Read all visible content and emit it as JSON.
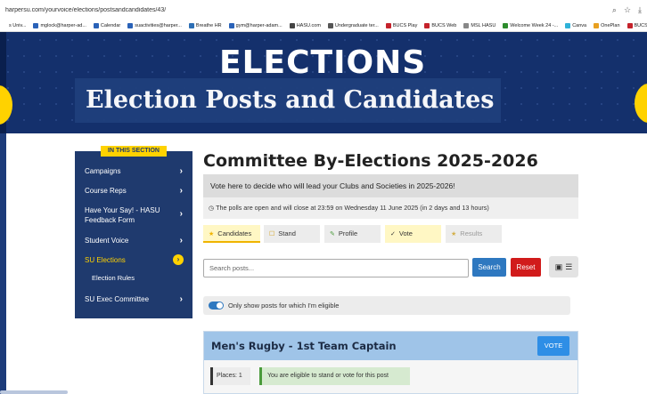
{
  "browser": {
    "url": "harpersu.com/yourvoice/elections/postsandcandidates/43/",
    "bookmarks": [
      {
        "label": "s Univ...",
        "color": "#ffffff"
      },
      {
        "label": "mglock@harper-ad...",
        "color": "#2a62b8"
      },
      {
        "label": "Calendar",
        "color": "#2a62b8"
      },
      {
        "label": "suactivities@harper...",
        "color": "#2a62b8"
      },
      {
        "label": "Breathe HR",
        "color": "#2d6fb5"
      },
      {
        "label": "gym@harper-adam...",
        "color": "#2a62b8"
      },
      {
        "label": "HASU.com",
        "color": "#444444"
      },
      {
        "label": "Undergraduate ter...",
        "color": "#555555"
      },
      {
        "label": "BUCS Play",
        "color": "#c5222b"
      },
      {
        "label": "BUCS Web",
        "color": "#c5222b"
      },
      {
        "label": "MSL HASU",
        "color": "#888888"
      },
      {
        "label": "Welcome Week 24 -...",
        "color": "#2d8c2d"
      },
      {
        "label": "Canva",
        "color": "#2fb2d8"
      },
      {
        "label": "OnePlan",
        "color": "#e8a020"
      },
      {
        "label": "BUCS",
        "color": "#c5222b"
      }
    ]
  },
  "hero": {
    "elections": "ELECTIONS",
    "title": "Election Posts and Candidates"
  },
  "sidebar": {
    "tag": "IN THIS SECTION",
    "items": [
      {
        "label": "Campaigns",
        "chevron": "›"
      },
      {
        "label": "Course Reps",
        "chevron": "›"
      },
      {
        "label": "Have Your Say! - HASU",
        "label2": "Feedback Form",
        "chevron": "›"
      },
      {
        "label": "Student Voice",
        "chevron": "›"
      },
      {
        "label": "SU Elections",
        "chevron": "›"
      },
      {
        "label": "Election Rules"
      },
      {
        "label": "SU Exec Committee",
        "chevron": "›"
      }
    ]
  },
  "main": {
    "heading": "Committee By-Elections 2025-2026",
    "banner": "Vote here to decide who will lead your Clubs and Societies in 2025-2026!",
    "closing": "The polls are open and will close at 23:59 on Wednesday 11 June 2025 (in 2 days and 13 hours)",
    "tabs": [
      {
        "label": "Candidates",
        "icon": "★"
      },
      {
        "label": "Stand",
        "icon": "☐"
      },
      {
        "label": "Profile",
        "icon": "✎"
      },
      {
        "label": "Vote",
        "icon": "✓"
      },
      {
        "label": "Results",
        "icon": "★"
      }
    ],
    "search_placeholder": "Search posts...",
    "search_button": "Search",
    "reset_button": "Reset",
    "eligible_label": "Only show posts for which I'm eligible",
    "post": {
      "title": "Men's Rugby - 1st Team Captain",
      "vote_button": "VOTE",
      "places": "Places: 1",
      "eligibility": "You are eligible to stand or vote for this post"
    }
  }
}
